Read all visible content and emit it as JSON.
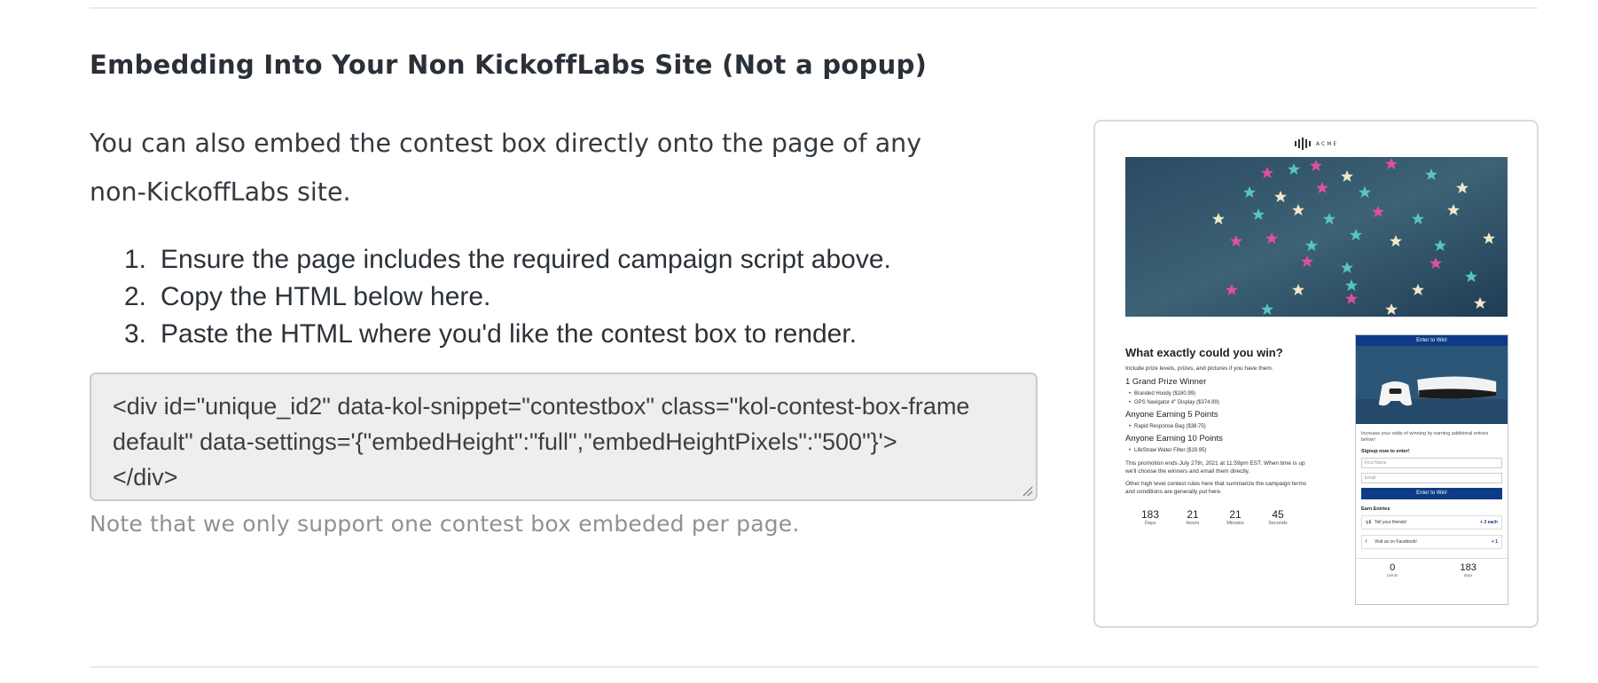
{
  "section": {
    "heading": "Embedding Into Your Non KickoffLabs Site (Not a popup)",
    "intro": "You can also embed the contest box directly onto the page of any non-KickoffLabs site.",
    "steps": [
      {
        "num": "1.",
        "text": "Ensure the page includes the required campaign script above."
      },
      {
        "num": "2.",
        "text": "Copy the HTML below here."
      },
      {
        "num": "3.",
        "text": "Paste the HTML where you'd like the contest box to render."
      }
    ],
    "code": "<div id=\"unique_id2\" data-kol-snippet=\"contestbox\" class=\"kol-contest-box-frame default\" data-settings='{\"embedHeight\":\"full\",\"embedHeightPixels\":\"500\"}'>\n</div>",
    "note": "Note that we only support one contest box embeded per page."
  },
  "preview": {
    "logo_text": "ACME",
    "title": "What exactly could you win?",
    "subtitle": "Include prize levels, prizes, and pictures if you have them.",
    "tiers": [
      {
        "name": "1 Grand Prize Winner",
        "prizes": [
          "Branded Hoody ($180.99)",
          "GPS Navigator 4\" Display ($374.99)"
        ]
      },
      {
        "name": "Anyone Earning 5 Points",
        "prizes": [
          "Rapid Response Bag ($38.75)"
        ]
      },
      {
        "name": "Anyone Earning 10 Points",
        "prizes": [
          "LifeStraw Water Filter ($19.95)"
        ]
      }
    ],
    "promo_text": "This promotion ends July 27th, 2021 at 11:59pm EST. When time is up we'll choose the winners and email them directly.",
    "rules_text": "Other high level contest rules here that summarize the campaign terms and conditions are generally put here.",
    "countdown": [
      {
        "value": "183",
        "label": "Days"
      },
      {
        "value": "21",
        "label": "Hours"
      },
      {
        "value": "21",
        "label": "Minutes"
      },
      {
        "value": "45",
        "label": "Seconds"
      }
    ],
    "widget": {
      "header": "Enter to Win!",
      "odds_text": "Increase your odds of winning by earning additional entries below!",
      "signup_label": "Signup now to enter!",
      "first_name_placeholder": "First Name",
      "email_placeholder": "Email",
      "enter_button": "Enter to Win!",
      "earn_label": "Earn Entries",
      "entries": [
        {
          "icon": "megaphone-icon",
          "text": "Tell your friends!",
          "points": "+ 3 each"
        },
        {
          "icon": "facebook-icon",
          "text": "Visit us on Facebook!",
          "points": "+ 1"
        }
      ],
      "stats": [
        {
          "value": "0",
          "label": "points"
        },
        {
          "value": "183",
          "label": "days"
        }
      ]
    }
  }
}
